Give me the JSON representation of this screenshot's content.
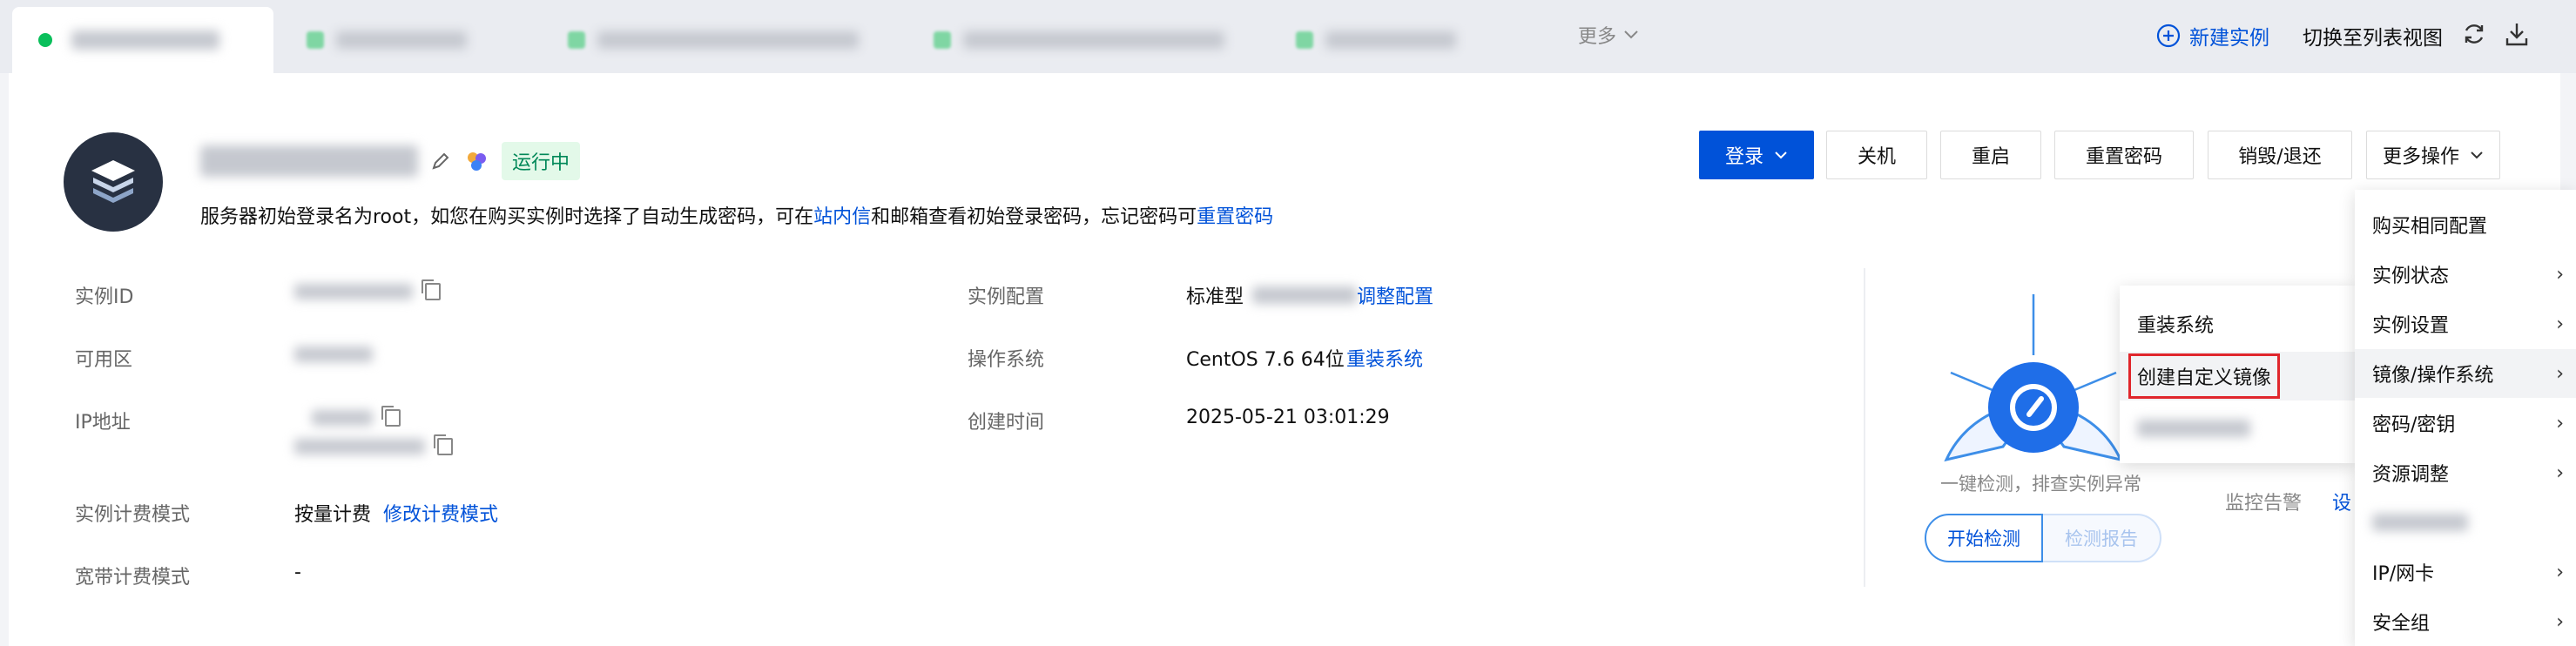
{
  "tabs": {
    "more_label": "更多"
  },
  "toolbar": {
    "new_instance": "新建实例",
    "switch_list": "切换至列表视图"
  },
  "instance": {
    "status": "运行中",
    "notice_prefix": "服务器初始登录名为root，如您在购买实例时选择了自动生成密码，可在",
    "notice_link1": "站内信",
    "notice_middle": "和邮箱查看初始登录密码，忘记密码可",
    "notice_link2": "重置密码"
  },
  "actions": {
    "login": "登录",
    "shutdown": "关机",
    "restart": "重启",
    "reset_password": "重置密码",
    "destroy": "销毁/退还",
    "more_ops": "更多操作"
  },
  "details": {
    "instance_id_label": "实例ID",
    "zone_label": "可用区",
    "ip_label": "IP地址",
    "billing_label": "实例计费模式",
    "billing_value": "按量计费",
    "billing_link": "修改计费模式",
    "bandwidth_label": "宽带计费模式",
    "bandwidth_value": "-",
    "config_label": "实例配置",
    "config_value": "标准型",
    "config_link": "调整配置",
    "os_label": "操作系统",
    "os_value": "CentOS 7.6 64位",
    "os_link": "重装系统",
    "created_label": "创建时间",
    "created_value": "2025-05-21 03:01:29"
  },
  "health": {
    "hint": "一键检测，排查实例异常",
    "start_check": "开始检测",
    "report": "检测报告",
    "monitor_label": "监控告警",
    "monitor_link": "设"
  },
  "more_menu": {
    "items": [
      "购买相同配置",
      "实例状态",
      "实例设置",
      "镜像/操作系统",
      "密码/密钥",
      "资源调整",
      "IP/网卡",
      "安全组"
    ]
  },
  "sub_menu": {
    "items": [
      "重装系统",
      "创建自定义镜像"
    ]
  },
  "colors": {
    "primary": "#0052d9",
    "running_bg": "#e3f9e9",
    "running_text": "#008858",
    "highlight_border": "#e0262c",
    "status_dot": "#0abf5b"
  }
}
